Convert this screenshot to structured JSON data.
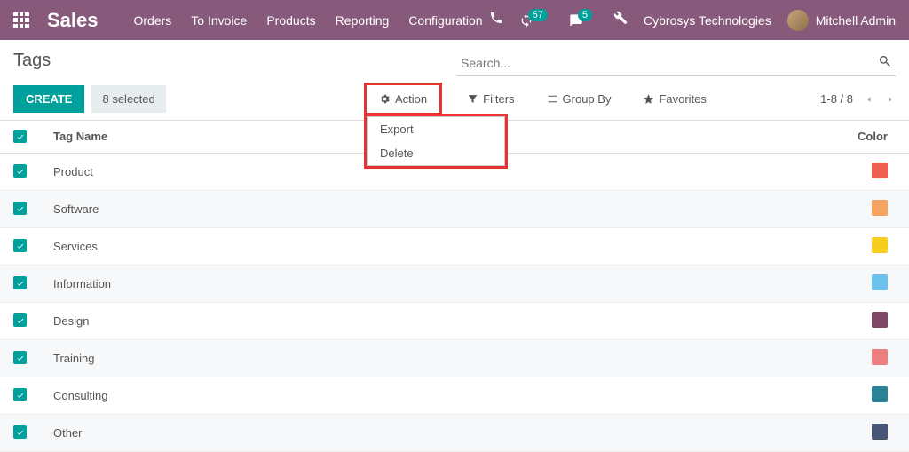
{
  "topbar": {
    "brand": "Sales",
    "nav": [
      "Orders",
      "To Invoice",
      "Products",
      "Reporting",
      "Configuration"
    ],
    "refresh_badge": "57",
    "chat_badge": "5",
    "company": "Cybrosys Technologies",
    "user_name": "Mitchell Admin"
  },
  "page": {
    "title": "Tags",
    "search_placeholder": "Search...",
    "create_label": "CREATE",
    "selected_label": "8 selected",
    "action_label": "Action",
    "filters_label": "Filters",
    "groupby_label": "Group By",
    "favorites_label": "Favorites",
    "pager": "1-8 / 8",
    "dropdown": [
      "Export",
      "Delete"
    ]
  },
  "table": {
    "header_name": "Tag Name",
    "header_color": "Color",
    "rows": [
      {
        "name": "Product",
        "color": "#f06050"
      },
      {
        "name": "Software",
        "color": "#f4a460"
      },
      {
        "name": "Services",
        "color": "#f7cd1f"
      },
      {
        "name": "Information",
        "color": "#6cc1ed"
      },
      {
        "name": "Design",
        "color": "#814968"
      },
      {
        "name": "Training",
        "color": "#eb7e7f"
      },
      {
        "name": "Consulting",
        "color": "#2c8397"
      },
      {
        "name": "Other",
        "color": "#475577"
      }
    ]
  }
}
